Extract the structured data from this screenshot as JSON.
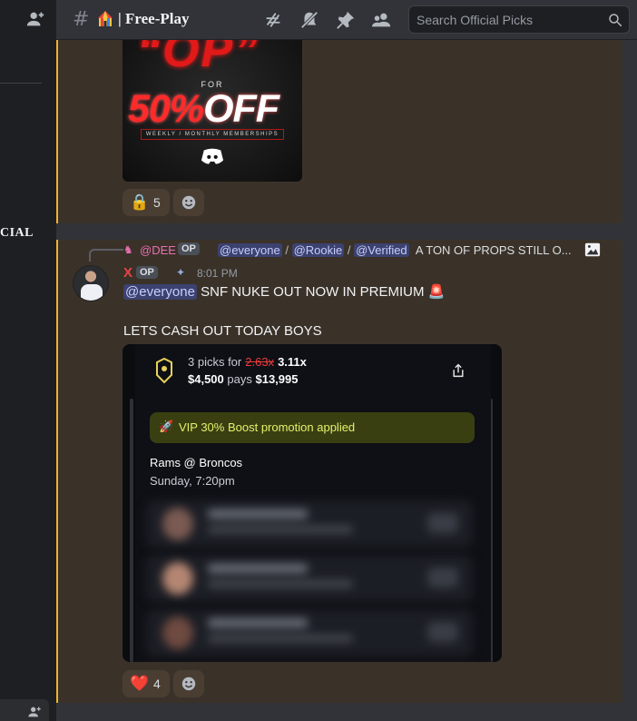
{
  "header": {
    "channel_name": "| Free-Play",
    "channel_emoji": "circus-tent",
    "search_placeholder": "Search Official Picks"
  },
  "sidebar": {
    "cut_label": "CIAL"
  },
  "message1": {
    "promo": {
      "op_text": "“OP”",
      "for_text": "FOR",
      "off_text_red": "50%",
      "off_text_white": "OFF",
      "membership_text": "WEEKLY / MONTHLY MEMBERSHIPS"
    },
    "reaction": {
      "emoji": "🔒",
      "count": "5"
    }
  },
  "message2": {
    "reply": {
      "author": "@DEE",
      "tag": "OP",
      "mention1": "@everyone",
      "sep1": "/",
      "mention2": "@Rookie",
      "sep2": "/",
      "mention3": "@Verified",
      "preview": "A TON OF PROPS STILL O..."
    },
    "author": {
      "name": "X",
      "tag": "OP",
      "time": "8:01 PM"
    },
    "content_mention": "@everyone",
    "content_text": " SNF NUKE OUT NOW IN PREMIUM ",
    "content_emoji": "🚨",
    "content_line2": "LETS CASH OUT TODAY BOYS",
    "screenshot": {
      "picks_prefix": "3 picks for",
      "old_mult": "2.63x",
      "new_mult": "3.11x",
      "stake": "$4,500",
      "pays_label": "pays",
      "payout": "$13,995",
      "boost_text": "VIP 30% Boost promotion applied",
      "boost_emoji": "🚀",
      "matchup": "Rams @ Broncos",
      "when": "Sunday, 7:20pm"
    },
    "reaction": {
      "emoji": "❤️",
      "count": "4"
    }
  },
  "colors": {
    "accent_bar": "#f0b232",
    "highlight_bg": "#3a3229",
    "mention_bg": "#3c4270",
    "author_red": "#ed4245",
    "reply_pink": "#e86fb2"
  }
}
